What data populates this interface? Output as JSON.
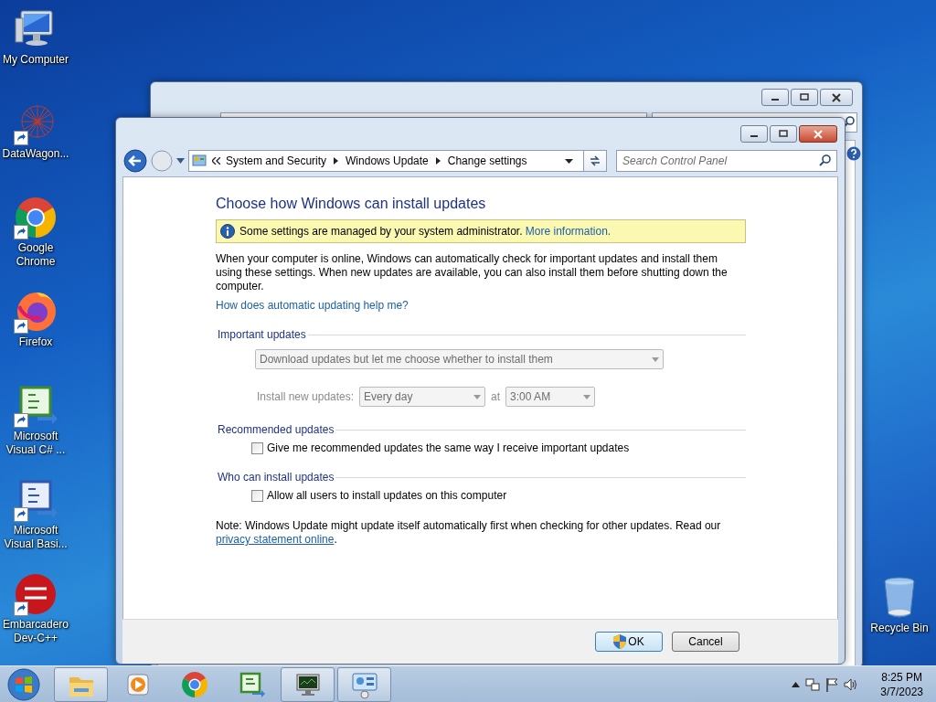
{
  "desktop_icons": [
    {
      "label": "My Computer",
      "kind": "computer",
      "shortcut": false
    },
    {
      "label": "DataWagon...",
      "kind": "web",
      "shortcut": true
    },
    {
      "label": "Google Chrome",
      "kind": "chrome",
      "shortcut": true
    },
    {
      "label": "Firefox",
      "kind": "firefox",
      "shortcut": true
    },
    {
      "label": "Microsoft Visual C# ...",
      "kind": "csharp",
      "shortcut": true
    },
    {
      "label": "Microsoft Visual Basi...",
      "kind": "vb",
      "shortcut": true
    },
    {
      "label": "Embarcadero Dev-C++",
      "kind": "devcpp",
      "shortcut": true
    }
  ],
  "recycle_bin": {
    "label": "Recycle Bin"
  },
  "window": {
    "breadcrumb": [
      "System and Security",
      "Windows Update",
      "Change settings"
    ],
    "search": {
      "placeholder": "Search Control Panel"
    },
    "heading": "Choose how Windows can install updates",
    "notice": {
      "text": "Some settings are managed by your system administrator.",
      "link": "More information."
    },
    "intro": "When your computer is online, Windows can automatically check for important updates and install them using these settings. When new updates are available, you can also install them before shutting down the computer.",
    "help_link": "How does automatic updating help me?",
    "sections": [
      {
        "title": "Important updates",
        "items": [
          {
            "kind": "dropdown",
            "value": "Download updates but let me choose whether to install them",
            "disabled": true
          },
          {
            "kind": "schedule",
            "label": "Install new updates:",
            "day": "Every day",
            "at": "at",
            "time": "3:00 AM",
            "disabled": true
          }
        ]
      },
      {
        "title": "Recommended updates",
        "items": [
          {
            "kind": "checkbox",
            "label": "Give me recommended updates the same way I receive important updates",
            "checked": false
          }
        ]
      },
      {
        "title": "Who can install updates",
        "items": [
          {
            "kind": "checkbox",
            "label": "Allow all users to install updates on this computer",
            "checked": false
          }
        ]
      }
    ],
    "note": {
      "text": "Note: Windows Update might update itself automatically first when checking for other updates.  Read our",
      "link": "privacy statement online",
      "end": "."
    },
    "buttons": [
      {
        "label": "OK",
        "shield": true
      },
      {
        "label": "Cancel",
        "shield": false
      }
    ]
  },
  "taskbar": {
    "apps": [
      {
        "kind": "explorer",
        "running": true
      },
      {
        "kind": "media",
        "running": false
      },
      {
        "kind": "chrome",
        "running": false
      },
      {
        "kind": "csharp",
        "running": false
      },
      {
        "kind": "monitor",
        "running": true
      },
      {
        "kind": "controlpanel",
        "running": true
      }
    ],
    "time": "8:25 PM",
    "date": "3/7/2023"
  }
}
